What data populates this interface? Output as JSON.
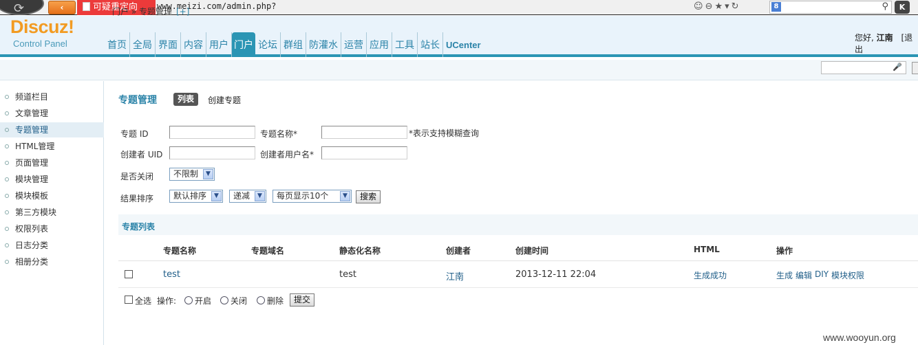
{
  "browser": {
    "warning_label": "可疑重定向",
    "url": "www.meizi.com/admin.php?",
    "back_glyph": "‹",
    "search_engine_glyph": "8",
    "extension_label": "K"
  },
  "header": {
    "logo_text": "Discuz!",
    "logo_subtitle": "Control Panel",
    "nav": [
      "首页",
      "全局",
      "界面",
      "内容",
      "用户",
      "门户",
      "论坛",
      "群组",
      "防灌水",
      "运营",
      "应用",
      "工具",
      "站长",
      "UCenter"
    ],
    "active_nav": "门户",
    "greeting_prefix": "您好, ",
    "username": "江南",
    "logout_label": "[退出"
  },
  "breadcrumb": {
    "text": "门户 » 专题管理",
    "add_label": "[+]"
  },
  "sidebar": {
    "items": [
      "频道栏目",
      "文章管理",
      "专题管理",
      "HTML管理",
      "页面管理",
      "模块管理",
      "模块模板",
      "第三方模块",
      "权限列表",
      "日志分类",
      "相册分类"
    ],
    "active": "专题管理"
  },
  "main": {
    "title": "专题管理",
    "tab_list": "列表",
    "tab_create": "创建专题"
  },
  "search_form": {
    "topic_id_label": "专题 ID",
    "topic_name_label": "专题名称*",
    "fuzzy_note": "*表示支持模糊查询",
    "creator_uid_label": "创建者 UID",
    "creator_name_label": "创建者用户名*",
    "closed_label": "是否关闭",
    "closed_value": "不限制",
    "sort_label": "结果排序",
    "sort_value": "默认排序",
    "order_value": "递减",
    "perpage_value": "每页显示10个",
    "search_button": "搜索"
  },
  "list": {
    "section_title": "专题列表",
    "columns": [
      "专题名称",
      "专题域名",
      "静态化名称",
      "创建者",
      "创建时间",
      "HTML",
      "操作"
    ],
    "rows": [
      {
        "name": "test",
        "domain": "",
        "static_name": "test",
        "creator": "江南",
        "created": "2013-12-11 22:04",
        "html_status": "生成成功",
        "actions": [
          "生成",
          "编辑",
          "DIY",
          "模块权限"
        ]
      }
    ]
  },
  "bulk": {
    "select_all": "全选",
    "operation_label": "操作:",
    "open": "开启",
    "close": "关闭",
    "delete": "删除",
    "submit": "提交"
  },
  "watermark": "www.wooyun.org"
}
